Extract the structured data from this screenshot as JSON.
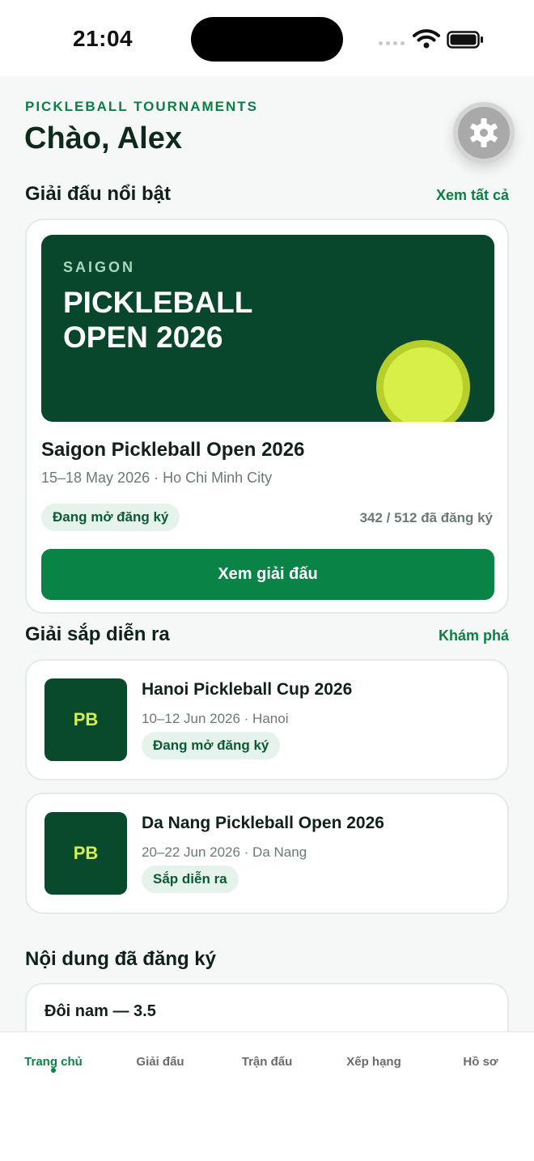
{
  "status": {
    "time": "21:04"
  },
  "header": {
    "eyebrow": "PICKLEBALL TOURNAMENTS",
    "greeting": "Chào, Alex"
  },
  "featured_section": {
    "title": "Giải đấu nổi bật",
    "link": "Xem tất cả"
  },
  "featured": {
    "banner_city": "SAIGON",
    "banner_title": "PICKLEBALL OPEN 2026",
    "name": "Saigon Pickleball Open 2026",
    "meta": "15–18 May 2026 · Ho Chi Minh City",
    "status": "Đang mở đăng ký",
    "registered": "342 / 512 đã đăng ký",
    "button": "Xem giải đấu"
  },
  "upcoming_section": {
    "title": "Giải sắp diễn ra",
    "link": "Khám phá"
  },
  "upcoming": [
    {
      "thumb": "PB",
      "name": "Hanoi Pickleball Cup 2026",
      "meta": "10–12 Jun 2026 · Hanoi",
      "status": "Đang mở đăng ký"
    },
    {
      "thumb": "PB",
      "name": "Da Nang Pickleball Open 2026",
      "meta": "20–22 Jun 2026 · Da Nang",
      "status": "Sắp diễn ra"
    }
  ],
  "registered_section": {
    "title": "Nội dung đã đăng ký"
  },
  "registered_events": [
    {
      "title": "Đôi nam — 3.5"
    }
  ],
  "tabs": [
    {
      "label": "Trang chủ",
      "active": true
    },
    {
      "label": "Giải đấu"
    },
    {
      "label": "Trận đấu"
    },
    {
      "label": "Xếp hạng"
    },
    {
      "label": "Hồ sơ"
    }
  ],
  "colors": {
    "brand_green": "#0a8446",
    "banner_green": "#08472b",
    "ball_yellow": "#d8ef4a"
  },
  "icons": {
    "settings": "gear-icon"
  }
}
